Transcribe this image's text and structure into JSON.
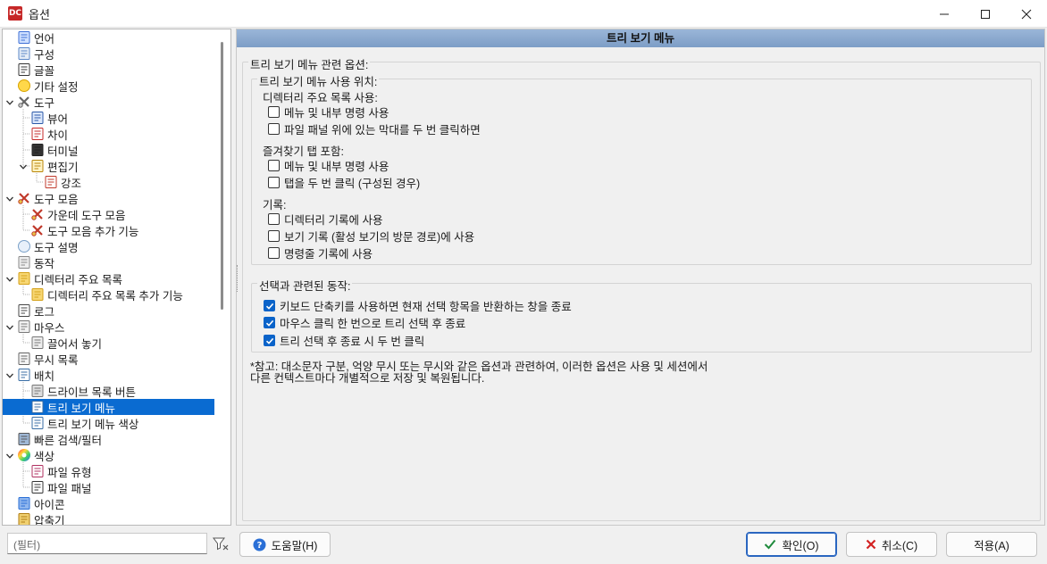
{
  "window": {
    "title": "옵션",
    "app_icon": "DC"
  },
  "sidebar": {
    "items": [
      {
        "label": "언어",
        "icon": "flag-icon",
        "indent": 0,
        "expander": "none"
      },
      {
        "label": "구성",
        "icon": "config-icon",
        "indent": 0,
        "expander": "none"
      },
      {
        "label": "글꼴",
        "icon": "font-icon",
        "indent": 0,
        "expander": "none"
      },
      {
        "label": "기타 설정",
        "icon": "smiley-icon",
        "indent": 0,
        "expander": "none"
      },
      {
        "label": "도구",
        "icon": "tools-icon",
        "indent": 0,
        "expander": "open"
      },
      {
        "label": "뷰어",
        "icon": "book-icon",
        "indent": 1,
        "expander": "none"
      },
      {
        "label": "차이",
        "icon": "diff-icon",
        "indent": 1,
        "expander": "none"
      },
      {
        "label": "터미널",
        "icon": "terminal-icon",
        "indent": 1,
        "expander": "none"
      },
      {
        "label": "편집기",
        "icon": "editor-icon",
        "indent": 1,
        "expander": "open"
      },
      {
        "label": "강조",
        "icon": "highlight-icon",
        "indent": 2,
        "expander": "none"
      },
      {
        "label": "도구 모음",
        "icon": "toolbar-icon",
        "indent": 0,
        "expander": "open"
      },
      {
        "label": "가운데 도구 모음",
        "icon": "toolbar-icon",
        "indent": 1,
        "expander": "none"
      },
      {
        "label": "도구 모음 추가 기능",
        "icon": "toolbar-icon",
        "indent": 1,
        "expander": "none"
      },
      {
        "label": "도구 설명",
        "icon": "bulb-icon",
        "indent": 0,
        "expander": "none"
      },
      {
        "label": "동작",
        "icon": "action-icon",
        "indent": 0,
        "expander": "none"
      },
      {
        "label": "디렉터리 주요 목록",
        "icon": "folder-icon",
        "indent": 0,
        "expander": "open"
      },
      {
        "label": "디렉터리 주요 목록 추가 기능",
        "icon": "folder-icon",
        "indent": 1,
        "expander": "none"
      },
      {
        "label": "로그",
        "icon": "log-icon",
        "indent": 0,
        "expander": "none"
      },
      {
        "label": "마우스",
        "icon": "mouse-icon",
        "indent": 0,
        "expander": "open"
      },
      {
        "label": "끌어서 놓기",
        "icon": "drag-icon",
        "indent": 1,
        "expander": "none"
      },
      {
        "label": "무시 목록",
        "icon": "ignore-icon",
        "indent": 0,
        "expander": "none"
      },
      {
        "label": "배치",
        "icon": "layout-icon",
        "indent": 0,
        "expander": "open"
      },
      {
        "label": "드라이브 목록 버튼",
        "icon": "drive-icon",
        "indent": 1,
        "expander": "none"
      },
      {
        "label": "트리 보기 메뉴",
        "icon": "tree-icon",
        "indent": 1,
        "expander": "none",
        "selected": true
      },
      {
        "label": "트리 보기 메뉴 색상",
        "icon": "tree-icon",
        "indent": 1,
        "expander": "none"
      },
      {
        "label": "빠른 검색/필터",
        "icon": "search-filter-icon",
        "indent": 0,
        "expander": "none"
      },
      {
        "label": "색상",
        "icon": "color-wheel-icon",
        "indent": 0,
        "expander": "open"
      },
      {
        "label": "파일 유형",
        "icon": "filetype-icon",
        "indent": 1,
        "expander": "none"
      },
      {
        "label": "파일 패널",
        "icon": "panel-icon",
        "indent": 1,
        "expander": "none"
      },
      {
        "label": "아이콘",
        "icon": "icons-icon",
        "indent": 0,
        "expander": "none"
      },
      {
        "label": "압축기",
        "icon": "archive-icon",
        "indent": 0,
        "expander": "none"
      }
    ]
  },
  "filter": {
    "placeholder": "(필터)"
  },
  "main": {
    "header": "트리 보기 메뉴",
    "group_options": {
      "legend": "트리 보기 메뉴 관련 옵션:",
      "usage": {
        "legend": "트리 보기 메뉴 사용 위치:",
        "section_hotlist": "디렉터리 주요 목록 사용:",
        "hotlist_menu": {
          "label": "메뉴 및 내부 명령 사용",
          "checked": false
        },
        "hotlist_dblclick": {
          "label": "파일 패널 위에 있는 막대를 두 번 클릭하면",
          "checked": false
        },
        "section_favtabs": "즐겨찾기 탭 포함:",
        "favtabs_menu": {
          "label": "메뉴 및 내부 명령 사용",
          "checked": false
        },
        "favtabs_dblclick": {
          "label": "탭을 두 번 클릭 (구성된 경우)",
          "checked": false
        },
        "section_history": "기록:",
        "history_dir": {
          "label": "디렉터리 기록에 사용",
          "checked": false
        },
        "history_view": {
          "label": "보기 기록 (활성 보기의 방문 경로)에 사용",
          "checked": false
        },
        "history_cmd": {
          "label": "명령줄 기록에 사용",
          "checked": false
        }
      }
    },
    "group_selection": {
      "legend": "선택과 관련된 동작:",
      "opt_keyboard": {
        "label": "키보드 단축키를 사용하면 현재 선택 항목을 반환하는 창을 종료",
        "checked": true
      },
      "opt_mouse_single": {
        "label": "마우스 클릭 한 번으로 트리 선택 후 종료",
        "checked": true
      },
      "opt_double_click": {
        "label": "트리 선택 후 종료 시 두 번 클릭",
        "checked": true
      }
    },
    "note_line1": "*참고: 대소문자 구분, 억양 무시 또는 무시와 같은 옵션과 관련하여, 이러한 옵션은 사용 및 세션에서",
    "note_line2": "다른 컨텍스트마다 개별적으로 저장 및 복원됩니다."
  },
  "buttons": {
    "help": "도움말(H)",
    "ok": "확인(O)",
    "cancel": "취소(C)",
    "apply": "적용(A)"
  },
  "colors": {
    "selection": "#0a6bd1",
    "header_band": "#8aa9cf",
    "checkbox_checked": "#0a63c9"
  }
}
